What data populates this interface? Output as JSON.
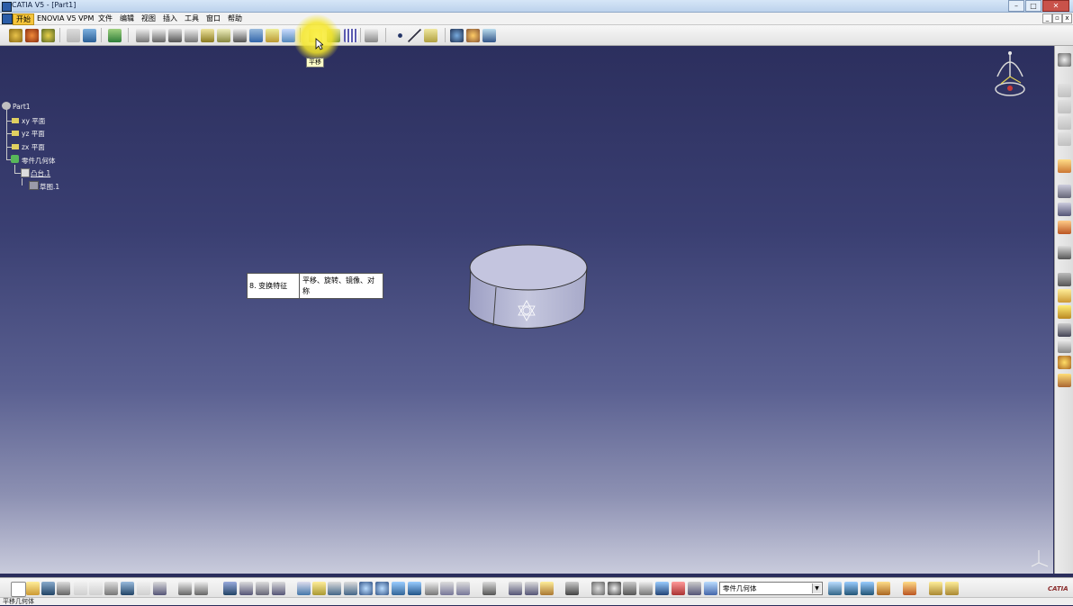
{
  "window": {
    "title": "CATIA V5 - [Part1]"
  },
  "menu": {
    "items": [
      "开始",
      "ENOVIA V5 VPM",
      "文件",
      "编辑",
      "视图",
      "插入",
      "工具",
      "窗口",
      "帮助"
    ],
    "active": "开始"
  },
  "tooltip": {
    "text": "平移"
  },
  "tree": {
    "root": "Part1",
    "planes": [
      "xy 平面",
      "yz 平面",
      "zx 平面"
    ],
    "body": "零件几何体",
    "pad": "凸台.1",
    "sketch": "草图.1"
  },
  "callout": {
    "label": "8. 变换特征",
    "description": "平移、旋转、镜像、对称"
  },
  "bottom_toolbar": {
    "current_body": "零件几何体",
    "dropdown_arrow": "▼"
  },
  "status": {
    "text": "平移几何体"
  },
  "logo": "CATIA",
  "colors": {
    "menu_active": "#f5c43a",
    "highlight": "#f5e628",
    "viewport_top": "#2c2f5e",
    "viewport_bottom": "#c9cbdc",
    "part_body": "#b9bbd6"
  }
}
